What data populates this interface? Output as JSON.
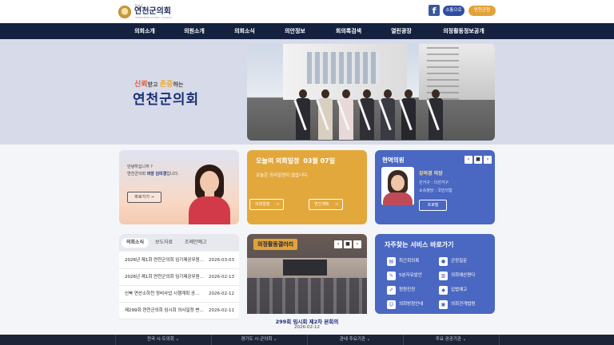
{
  "header": {
    "logo_small": "경기도",
    "logo_main": "연천군의회",
    "logo_sub": "YEONCHEON COUNTY COUNCIL",
    "fb_icon": "f",
    "btn_login": "소통으로",
    "btn_parliament": "연천군청"
  },
  "nav": [
    "의회소개",
    "의원소개",
    "의회소식",
    "의안정보",
    "회의록검색",
    "열린광장",
    "의정활동정보공개"
  ],
  "hero": {
    "slogan_1": "신뢰",
    "slogan_mid": "받고 ",
    "slogan_2": "존중",
    "slogan_end": "하는",
    "title": "연천군의회"
  },
  "greeting": {
    "line1": "안녕하십니까 ?",
    "line2_prefix": "연천군의회 ",
    "line2_bold": "의장 김미경",
    "line2_suffix": "입니다.",
    "button": "바로가기"
  },
  "schedule": {
    "title": "오늘의 의회일정",
    "date": "03월 07일",
    "message": "오늘은 의사일정이 없습니다.",
    "btn1": "의회일정",
    "btn2": "연간계획"
  },
  "members": {
    "title": "현역의원",
    "name": "강의경 의장",
    "district": "선거구 : 다선거구",
    "party": "소속정당 : 국민의힘",
    "button": "프로필"
  },
  "news": {
    "tabs": [
      "의회소식",
      "보도자료",
      "조례안예고"
    ],
    "rows": [
      {
        "title": "2026년 제1회 연천군의회 임기제공무원 ...",
        "date": "2026-03-03"
      },
      {
        "title": "2026년 제1회 연천군의회 임기제공무원 ...",
        "date": "2026-02-13"
      },
      {
        "title": "신북 연산소하천 정비사업 시행계획 공...",
        "date": "2026-02-12"
      },
      {
        "title": "제299회 연천군의회 임시회 의사일정 변...",
        "date": "2026-02-11"
      }
    ]
  },
  "gallery": {
    "label": "의정활동갤러리",
    "caption": "299회 임시회 제2차 본회의",
    "date": "2026-02-12"
  },
  "services": {
    "title": "자주찾는 서비스 바로가기",
    "items": [
      "최근회의록",
      "군정질문",
      "5분자유발언",
      "의회예산편다",
      "청원진정",
      "입법예고",
      "의회방청안내",
      "의회견개법령"
    ]
  },
  "footer": [
    "전국 시·도의회 ⌄",
    "경기도 시·군의회 ⌄",
    "관내 주요기관 ⌄",
    "주요 공공기관 ⌄"
  ],
  "controls": {
    "prev": "‹",
    "pause": "■",
    "next": "›",
    "arrow": "→"
  },
  "colors": {
    "navy": "#14213f",
    "gold": "#e3a83c",
    "blue": "#4a67c2",
    "footer": "#1d2438"
  }
}
